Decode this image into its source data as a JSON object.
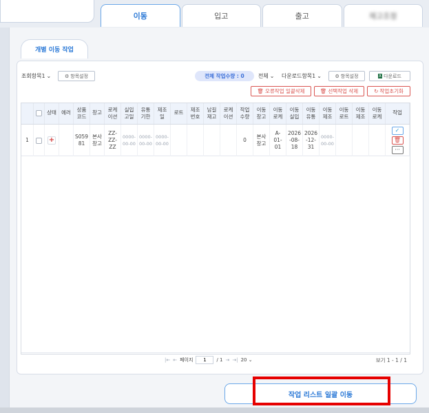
{
  "tabs": [
    {
      "label": "이동",
      "active": true
    },
    {
      "label": "입고"
    },
    {
      "label": "출고"
    },
    {
      "label": "재고조정"
    }
  ],
  "section_title": "개별 이동 작업",
  "toolbar": {
    "query_select": "조회항목1",
    "settings": "항목설정",
    "total_label": "전체 작업수량 : 0",
    "all_select": "전체",
    "download_select": "다운로드항목1",
    "settings2": "항목설정",
    "download": "다운로드",
    "delete_error": "오류작업 일괄삭제",
    "delete_selected": "선택작업 삭제",
    "reset": "작업초기화"
  },
  "columns": [
    "상태",
    "에러",
    "상품\n코드",
    "창고",
    "로케\n이션",
    "실입\n고일",
    "유통\n기한",
    "제조\n일",
    "로트",
    "제조\n번호",
    "남길\n재고\n",
    "로케\n이션\n",
    "작업\n수량",
    "이동\n창고",
    "이동\n로케\n",
    "이동\n실입\n",
    "이동\n유통\n",
    "이동\n제조\n",
    "이동\n로트",
    "이동\n제조\n",
    "이동\n로케\n",
    "작업"
  ],
  "rows": [
    {
      "no": "1",
      "product_code": "S059\n81",
      "warehouse": "본사\n창고",
      "location": "ZZ-\nZZ-\nZZ",
      "recv_date": "0000-\n00-00",
      "expiry": "0000-\n00-00",
      "mfg": "0000-\n00-00",
      "qty": "0",
      "move_wh": "본사\n창고",
      "move_loc": "A-\n01-\n01",
      "move_recv": "2026\n-08-\n18",
      "move_exp": "2026\n-12-\n31",
      "move_mfg": "0000-\n00-00"
    }
  ],
  "pager": {
    "page_label": "페이지",
    "page": "1",
    "of": "/ 1",
    "size": "20",
    "view": "보기 1 - 1 / 1"
  },
  "main_button": "작업 리스트 일괄 이동",
  "colors": {
    "accent": "#2a78d6",
    "danger": "#d9534f",
    "highlight": "#e60000"
  }
}
